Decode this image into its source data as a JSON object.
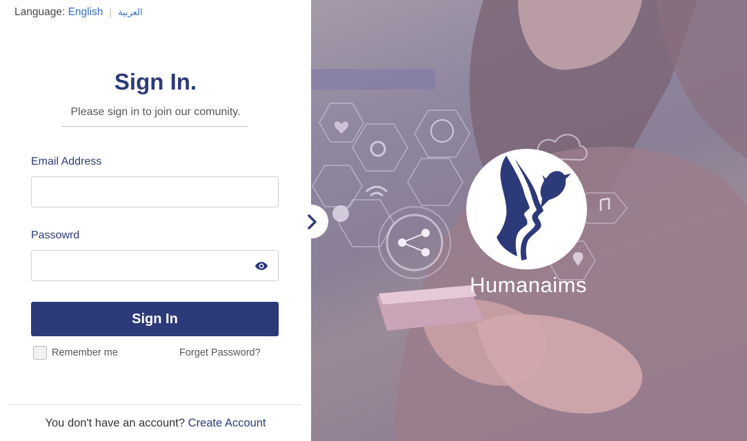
{
  "language": {
    "label": "Language:",
    "current": "English",
    "alternate": "العربية"
  },
  "heading": {
    "title": "Sign In.",
    "subtitle": "Please sign in to join our comunity."
  },
  "form": {
    "email_label": "Email Address",
    "email_value": "",
    "password_label": "Passowrd",
    "password_value": "",
    "submit_label": "Sign In",
    "remember_label": "Remember me",
    "remember_checked": false,
    "forgot_label": "Forget Password?"
  },
  "footer": {
    "prompt": "You don't have an account?",
    "link": "Create Account"
  },
  "brand": {
    "name": "Humanaims"
  },
  "colors": {
    "primary": "#2c3a7a",
    "link": "#2f6fd1",
    "overlay": "#8a7f96"
  },
  "icons": {
    "toggle": "chevron-right-icon",
    "password_toggle": "eye-icon"
  }
}
